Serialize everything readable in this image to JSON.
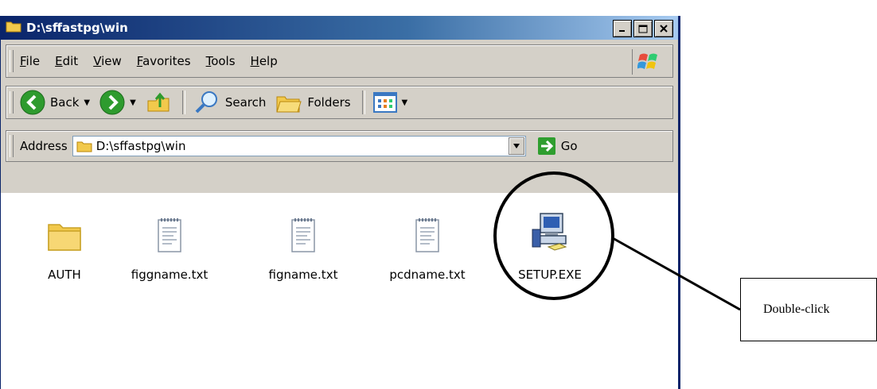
{
  "window": {
    "title": "D:\\sffastpg\\win"
  },
  "menu": {
    "items": [
      {
        "label": "File"
      },
      {
        "label": "Edit"
      },
      {
        "label": "View"
      },
      {
        "label": "Favorites"
      },
      {
        "label": "Tools"
      },
      {
        "label": "Help"
      }
    ]
  },
  "toolbar": {
    "back_label": "Back",
    "search_label": "Search",
    "folders_label": "Folders"
  },
  "address": {
    "label": "Address",
    "value": "D:\\sffastpg\\win",
    "go_label": "Go"
  },
  "files": [
    {
      "name": "AUTH",
      "icon": "folder-icon"
    },
    {
      "name": "figgname.txt",
      "icon": "text-file-icon"
    },
    {
      "name": "figname.txt",
      "icon": "text-file-icon"
    },
    {
      "name": "pcdname.txt",
      "icon": "text-file-icon"
    },
    {
      "name": "SETUP.EXE",
      "icon": "setup-exe-icon"
    }
  ],
  "callout": {
    "text": "Double-click"
  },
  "colors": {
    "titlebar": "#0a246a",
    "chrome": "#d4d0c8",
    "go_green": "#2f9e2f"
  }
}
